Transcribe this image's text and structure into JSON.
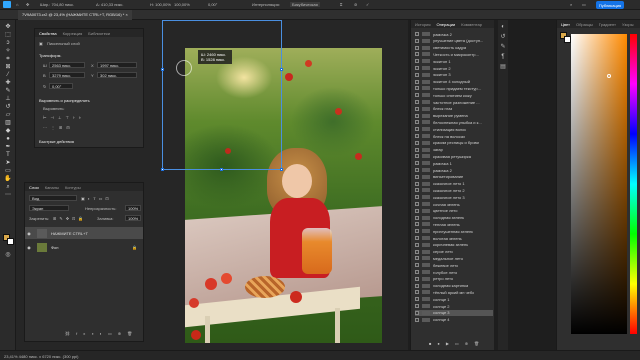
{
  "topbar": {
    "zoom_value": "100,00%",
    "options": [
      "Шир.: 704,80 пикс.",
      "Δ: 410,33 пикс.",
      "H: 100,00%",
      "0,00°",
      "Интерполяция:",
      "Бикубическая"
    ]
  },
  "publish_label": "Публикация",
  "doc_tab": "7V9A0073.cr2 @ 23,4% (НАЖМИТЕ CTRL+T, RGB/16) *",
  "tools": [
    "move",
    "marquee",
    "lasso",
    "magic-wand",
    "crop",
    "frame",
    "eyedropper",
    "heal",
    "brush",
    "stamp",
    "history-brush",
    "eraser",
    "gradient",
    "blur",
    "dodge",
    "pen",
    "type",
    "path-select",
    "shape",
    "hand",
    "zoom",
    "more"
  ],
  "props": {
    "tabs": [
      "Свойства",
      "Коррекция",
      "Библиотеки"
    ],
    "layer_type": "Пиксельный слой",
    "section_transform": "Трансформ.",
    "w_label": "Ш",
    "w_value": "2563 пикс.",
    "x_label": "X",
    "x_value": "1997 пикс.",
    "h_label": "В",
    "h_value": "3279 пикс.",
    "y_label": "Y",
    "y_value": "302 пикс.",
    "angle_value": "0,00°",
    "section_align": "Выровнять и распределить",
    "align_label": "Выровнять:",
    "section_quick": "Быстрые действия"
  },
  "layers": {
    "tabs": [
      "Слои",
      "Каналы",
      "Контуры"
    ],
    "search_placeholder": "Вид",
    "blend_mode": "Экран",
    "opacity_label": "Непрозрачность:",
    "opacity_value": "100%",
    "lock_label": "Закрепить:",
    "fill_label": "Заливка:",
    "fill_value": "100%",
    "rows": [
      {
        "name": "НАЖМИТЕ CTRL+T",
        "selected": true
      },
      {
        "name": "Фон",
        "selected": false
      }
    ]
  },
  "history": {
    "tabs": [
      "История",
      "Операции",
      "Комментар"
    ],
    "items": [
      "рамочка 2",
      "улучшение цвета (доступ...",
      "светимость кадра",
      "Четкость и микроконтр...",
      "эскитон 1",
      "эскитон 2",
      "эскитон 3",
      "эскитон 4 холодный",
      "только придаем текстур...",
      "только снятием кожу",
      "частотное разложение ...",
      "блеск глаз",
      "вырезание румена",
      "белоснежная улыбка и к...",
      "стилизация волос",
      "блеск на волосах",
      "красим ресницы и брови",
      "загар",
      "красивая ретуширка",
      "рамочка 1",
      "рамочка 2",
      "виньетирование",
      "сказочное лето 1",
      "сказочное лето 2",
      "сказочное лето 3",
      "сочная зелень",
      "цветное лето",
      "холодная зелень",
      "теплая зелень",
      "приглушенная зелень",
      "волотая зелень",
      "коричневая зелень",
      "серое лето",
      "медальное лето",
      "бежевое лето",
      "голубое лето",
      "ретро лето",
      "холодная картинка",
      "тёплый яркий мн чебо",
      "солнце 1",
      "солнце 2",
      "солнце 3",
      "солнце 4"
    ],
    "highlighted_index": 41
  },
  "color": {
    "tabs": [
      "Цвет",
      "Образцы",
      "Градиент",
      "Узоры"
    ]
  },
  "transform_tip": {
    "line1": "Ш: 2460 пикс.",
    "line2": "В: 1528 пикс."
  },
  "status": "23,41%    4480 пикс. x 6720 пикс. (300 ppi)",
  "accent": "#1473e6"
}
